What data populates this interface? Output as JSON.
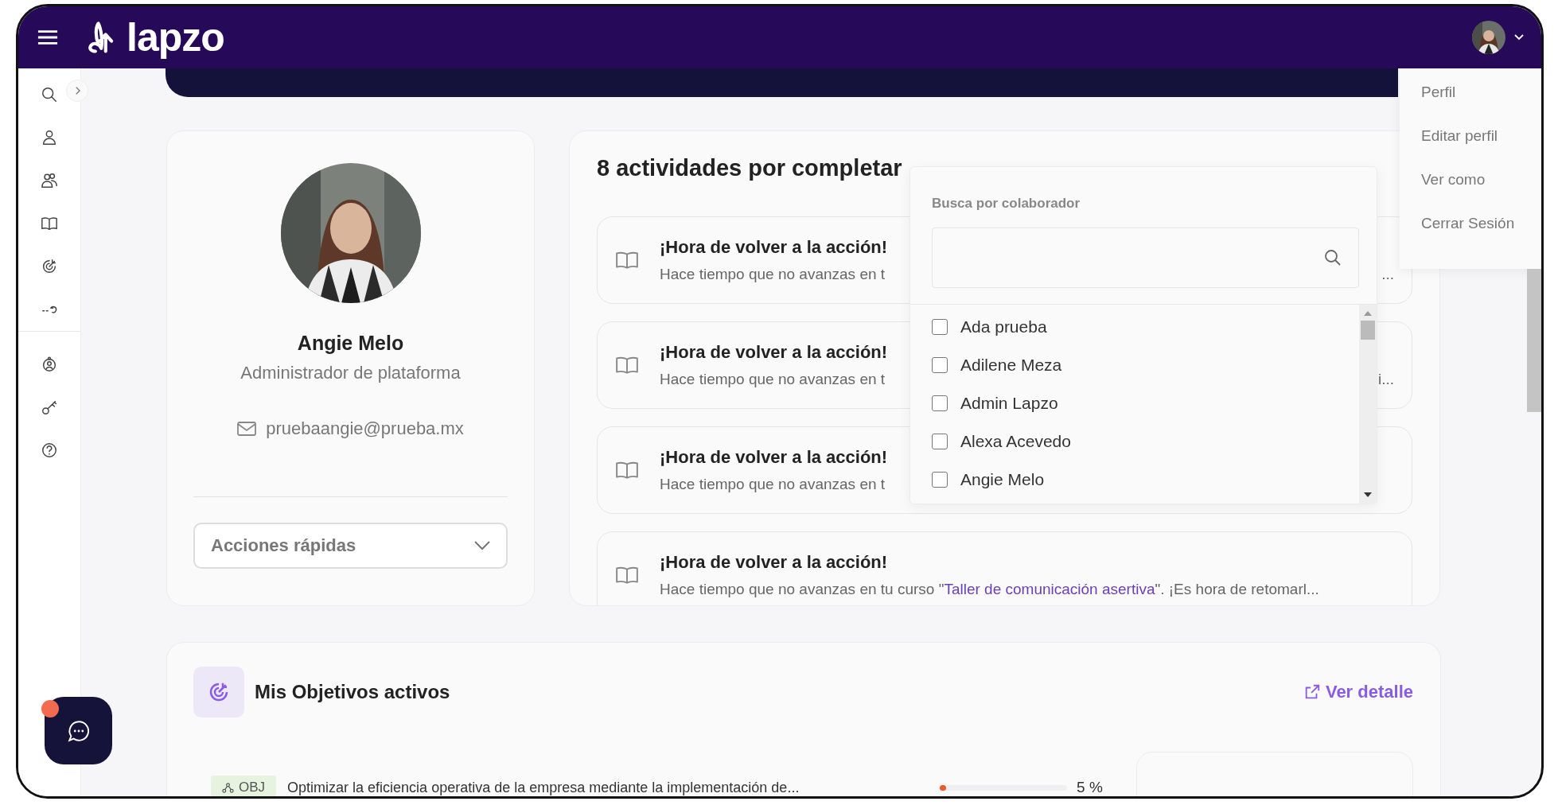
{
  "header": {
    "logo": "lapzo"
  },
  "profile": {
    "name": "Angie Melo",
    "role": "Administrador de plataforma",
    "email": "pruebaangie@prueba.mx",
    "quick_actions": "Acciones rápidas"
  },
  "activities": {
    "title": "8 actividades por completar",
    "items": [
      {
        "title": "¡Hora de volver a la acción!",
        "desc": "Hace tiempo que no avanzas en t",
        "tail": "..."
      },
      {
        "title": "¡Hora de volver a la acción!",
        "desc": "Hace tiempo que no avanzas en t",
        "tail": "i..."
      },
      {
        "title": "¡Hora de volver a la acción!",
        "desc": "Hace tiempo que no avanzas en t"
      },
      {
        "title": "¡Hora de volver a la acción!",
        "desc": "Hace tiempo que no avanzas en tu curso \"",
        "link": "Taller de comunicación asertiva",
        "desc_after": "\". ¡Es hora de retomarl..."
      }
    ]
  },
  "collaborator_filter": {
    "label": "Busca por colaborador",
    "options": [
      {
        "name": "Ada prueba",
        "checked": false
      },
      {
        "name": "Adilene Meza",
        "checked": false
      },
      {
        "name": "Admin Lapzo",
        "checked": false
      },
      {
        "name": "Alexa Acevedo",
        "checked": false
      },
      {
        "name": "Angie Melo",
        "checked": false
      }
    ]
  },
  "profile_menu": [
    "Perfil",
    "Editar perfil",
    "Ver como",
    "Cerrar Sesión"
  ],
  "objectives": {
    "title": "Mis Objetivos activos",
    "link": "Ver detalle",
    "rows": [
      {
        "tag": "OBJ",
        "text": "Optimizar la eficiencia operativa de la empresa mediante la implementación de...",
        "level": 0.05,
        "percent": "5 %"
      }
    ]
  }
}
